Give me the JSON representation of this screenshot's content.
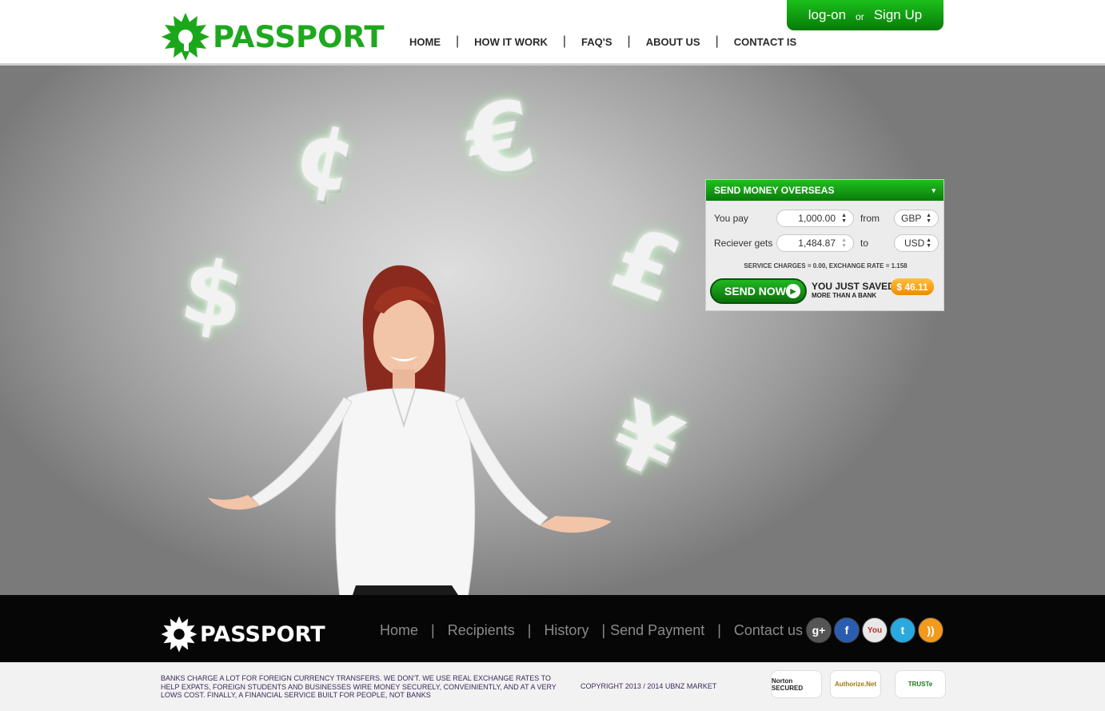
{
  "header": {
    "logo_text": "PASSPORT",
    "nav": [
      "HOME",
      "HOW IT WORK",
      "FAQ'S",
      "ABOUT US",
      "CONTACT IS"
    ],
    "nav_sep": "|",
    "auth": {
      "login": "log-on",
      "or": "or",
      "signup": "Sign Up"
    }
  },
  "hero": {
    "symbols": {
      "cent": "¢",
      "euro": "€",
      "dollar": "$",
      "pound": "£",
      "yen": "¥"
    }
  },
  "widget": {
    "title": "SEND MONEY OVERSEAS",
    "caret": "▾",
    "pay_label": "You pay",
    "pay_amount": "1,000.00",
    "from_label": "from",
    "from_currency": "GBP",
    "gets_label": "Reciever gets",
    "gets_amount": "1,484.87",
    "to_label": "to",
    "to_currency": "USD",
    "note": "SERVICE CHARGES = 0.00, EXCHANGE RATE = 1.158",
    "send_label": "SEND NOW",
    "send_arrow": "▶",
    "saved_line1": "YOU JUST SAVED",
    "saved_line2": "MORE THAN A BANK",
    "saved_value": "$ 46.11",
    "spinner_arrows": "▲▼"
  },
  "footer": {
    "logo_text": "PASSPORT",
    "nav": [
      "Home",
      "Recipients",
      "History",
      "Send Payment",
      "Contact us"
    ],
    "nav_sep": "|",
    "social": [
      {
        "icon": "google-plus-icon",
        "glyph": "g+",
        "color": "#555555"
      },
      {
        "icon": "facebook-icon",
        "glyph": "f",
        "color": "#2a5db0"
      },
      {
        "icon": "youtube-icon",
        "glyph": "You",
        "color": "#d9d9d9"
      },
      {
        "icon": "twitter-icon",
        "glyph": "t",
        "color": "#29a9e0"
      },
      {
        "icon": "rss-icon",
        "glyph": "))",
        "color": "#f39a1e"
      }
    ],
    "disclaimer": "BANKS CHARGE A LOT FOR FOREIGN CURRENCY TRANSFERS. WE DON'T. WE USE REAL EXCHANGE RATES TO HELP EXPATS, FOREIGN STUDENTS AND BUSINESSES WIRE MONEY SECURELY, CONVEINIENTLY, AND AT A VERY LOWS COST. FINALLY, A FINANCIAL SERVICE BUILT FOR PEOPLE, NOT BANKS",
    "copyright": "COPYRIGHT 2013 / 2014 UBNZ MARKET",
    "seals": [
      "Norton SECURED",
      "Authorize.Net",
      "TRUSTe"
    ]
  }
}
